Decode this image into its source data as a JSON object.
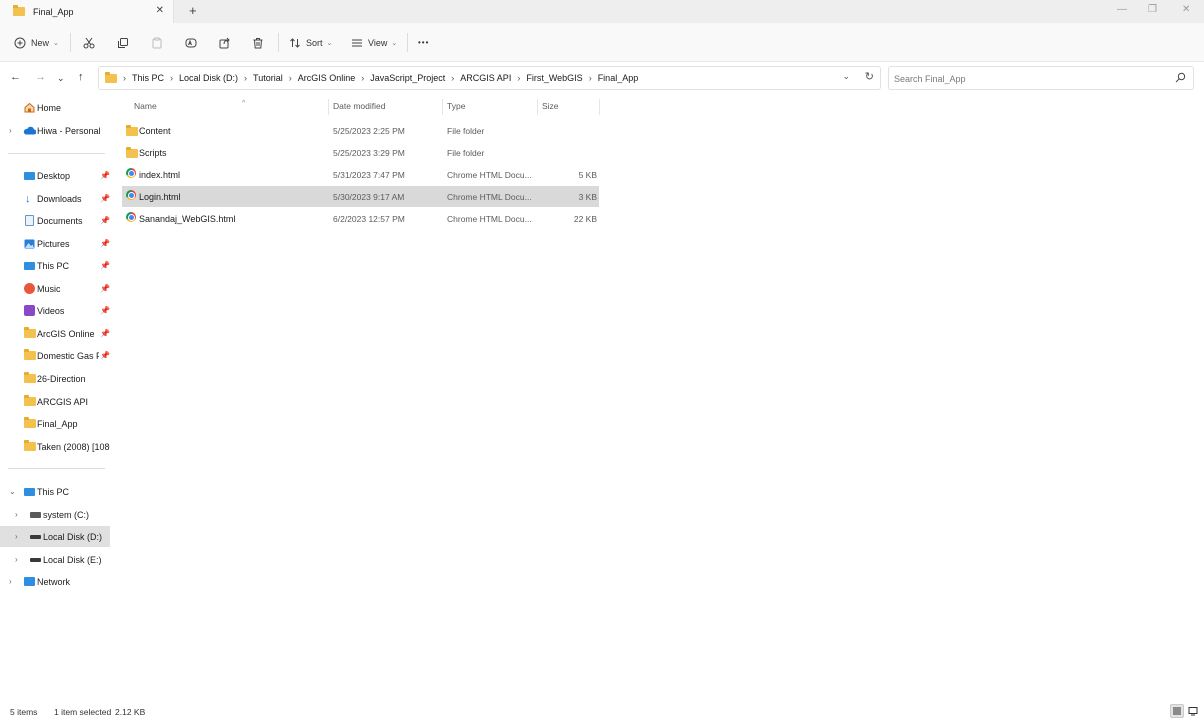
{
  "window": {
    "tab_title": "Final_App",
    "tab_close": "✕",
    "new_tab": "+",
    "minimize": "—",
    "restore": "❐",
    "close": "✕"
  },
  "toolbar": {
    "new_label": "New",
    "sort_label": "Sort",
    "view_label": "View",
    "more_label": "•••"
  },
  "address": {
    "crumbs": [
      "This PC",
      "Local Disk (D:)",
      "Tutorial",
      "ArcGIS Online",
      "JavaScript_Project",
      "ARCGIS API",
      "First_WebGIS",
      "Final_App"
    ],
    "separator": "›",
    "search_placeholder": "Search Final_App"
  },
  "sidebar": {
    "home": "Home",
    "onedrive": "Hiwa - Personal",
    "quick": [
      "Desktop",
      "Downloads",
      "Documents",
      "Pictures",
      "This PC",
      "Music",
      "Videos",
      "ArcGIS Online",
      "Domestic Gas Pi",
      "26-Direction",
      "ARCGIS API",
      "Final_App",
      "Taken (2008) [1080p"
    ],
    "this_pc": "This PC",
    "drives": [
      "system (C:)",
      "Local Disk (D:)",
      "Local Disk (E:)"
    ],
    "network": "Network"
  },
  "columns": {
    "name": "Name",
    "date": "Date modified",
    "type": "Type",
    "size": "Size"
  },
  "files": [
    {
      "name": "Content",
      "date": "5/25/2023 2:25 PM",
      "type": "File folder",
      "size": "",
      "kind": "folder"
    },
    {
      "name": "Scripts",
      "date": "5/25/2023 3:29 PM",
      "type": "File folder",
      "size": "",
      "kind": "folder"
    },
    {
      "name": "index.html",
      "date": "5/31/2023 7:47 PM",
      "type": "Chrome HTML Docu...",
      "size": "5 KB",
      "kind": "chrome"
    },
    {
      "name": "Login.html",
      "date": "5/30/2023 9:17 AM",
      "type": "Chrome HTML Docu...",
      "size": "3 KB",
      "kind": "chrome",
      "selected": true
    },
    {
      "name": "Sanandaj_WebGIS.html",
      "date": "6/2/2023 12:57 PM",
      "type": "Chrome HTML Docu...",
      "size": "22 KB",
      "kind": "chrome"
    }
  ],
  "status": {
    "items": "5 items",
    "selected": "1 item selected",
    "size": "2.12 KB"
  },
  "colors": {
    "folder": "#f2c14e",
    "selection": "#d9d9d9",
    "drive_selected": "#e0e0e0"
  }
}
